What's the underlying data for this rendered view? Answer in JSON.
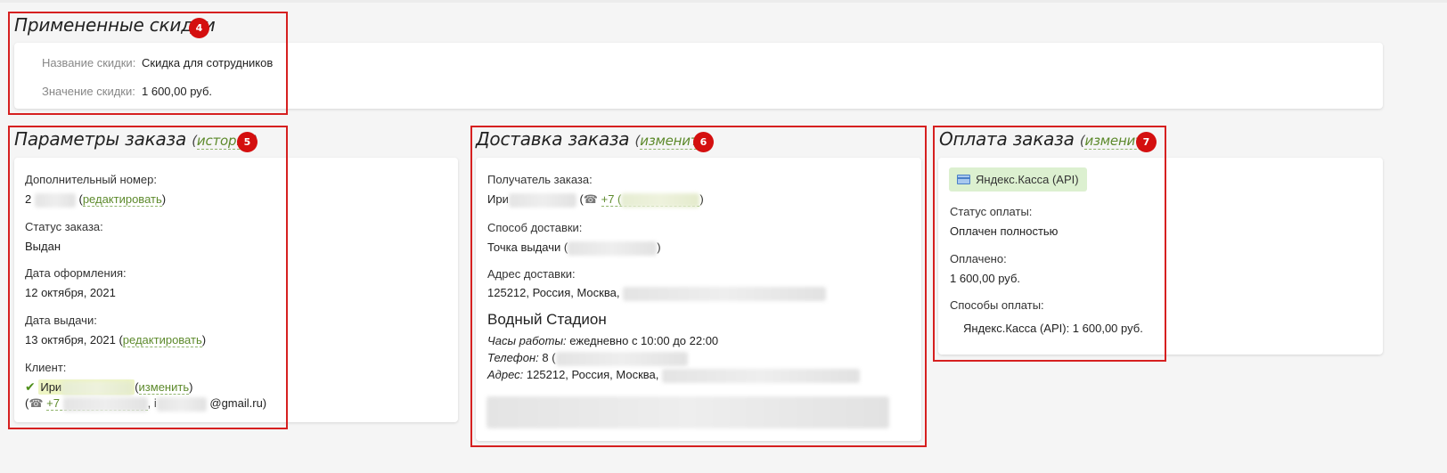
{
  "discounts": {
    "title": "Примененные скидки",
    "badge": "4",
    "name_label": "Название скидки:",
    "name_value": "Скидка для сотрудников",
    "value_label": "Значение скидки:",
    "value_value": "1 600,00 руб."
  },
  "params": {
    "title": "Параметры заказа",
    "history_link": "история",
    "badge": "5",
    "extra_number_label": "Дополнительный номер:",
    "extra_number_prefix": "2",
    "edit_link": "редактировать",
    "status_label": "Статус заказа:",
    "status_value": "Выдан",
    "created_label": "Дата оформления:",
    "created_value": "12 октября, 2021",
    "issued_label": "Дата выдачи:",
    "issued_value": "13 октября, 2021",
    "edit_link2": "редактировать",
    "client_label": "Клиент:",
    "client_name_prefix": "Ири",
    "change_link": "изменить",
    "phone_prefix": "+7",
    "email_prefix": "i",
    "email_suffix": "@gmail.ru)"
  },
  "delivery": {
    "title": "Доставка заказа",
    "change_link": "изменить",
    "badge": "6",
    "recipient_label": "Получатель заказа:",
    "recipient_prefix": "Ири",
    "recipient_phone": "+7 (",
    "method_label": "Способ доставки:",
    "method_value": "Точка выдачи (",
    "address_label": "Адрес доставки:",
    "address_value": "125212, Россия, Москва,",
    "point_name": "Водный Стадион",
    "hours_label": "Часы работы:",
    "hours_value": "ежедневно с 10:00 до 22:00",
    "phone_label": "Телефон:",
    "phone_value": "8 (",
    "addr_label": "Адрес:",
    "addr_value": "125212, Россия, Москва,"
  },
  "payment": {
    "title": "Оплата заказа",
    "change_link": "изменить",
    "badge": "7",
    "method_button": "Яндекс.Касса (API)",
    "status_label": "Статус оплаты:",
    "status_value": "Оплачен полностью",
    "paid_label": "Оплачено:",
    "paid_value": "1 600,00 руб.",
    "methods_label": "Способы оплаты:",
    "methods_value": "Яндекс.Касса (API): 1 600,00 руб."
  },
  "colors": {
    "callout": "#d62020",
    "badge": "#d40f0f",
    "link": "#5d8a2c",
    "pay_button_bg": "#dcf0d0"
  }
}
